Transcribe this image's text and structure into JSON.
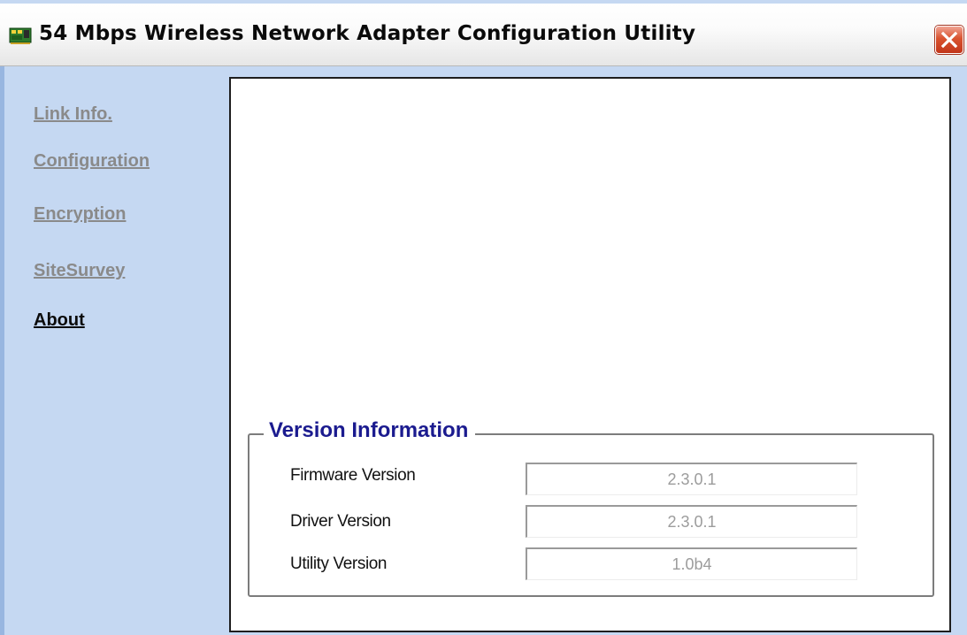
{
  "window": {
    "title": "54 Mbps Wireless Network Adapter Configuration Utility"
  },
  "nav": {
    "items": [
      {
        "label": "Link Info.",
        "active": false
      },
      {
        "label": "Configuration",
        "active": false
      },
      {
        "label": "Encryption",
        "active": false
      },
      {
        "label": "SiteSurvey",
        "active": false
      },
      {
        "label": "About",
        "active": true
      }
    ]
  },
  "version_info": {
    "title": "Version Information",
    "rows": [
      {
        "label": "Firmware Version",
        "value": "2.3.0.1"
      },
      {
        "label": "Driver Version",
        "value": "2.3.0.1"
      },
      {
        "label": "Utility Version",
        "value": "1.0b4"
      }
    ]
  },
  "icons": {
    "app": "network-adapter-icon",
    "close": "close-icon"
  },
  "colors": {
    "close_button": "#d9532f",
    "group_title": "#1b1b8f",
    "sidebar": "#c5d8f2"
  }
}
